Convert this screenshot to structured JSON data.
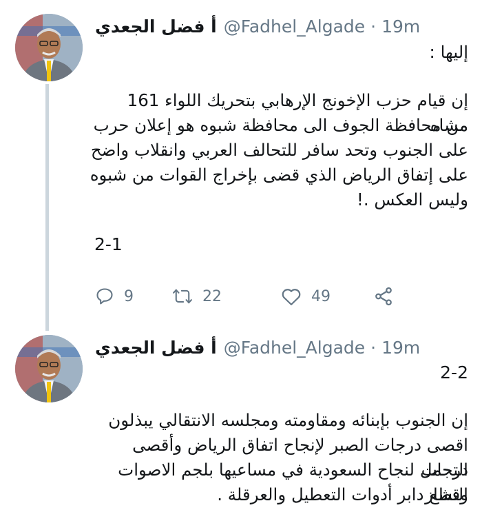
{
  "tweets": [
    {
      "author_name": "أ فضل الجعدي",
      "handle": "@Fadhel_Algade",
      "separator": "·",
      "time": "19m",
      "lines": [
        "إليها :",
        "إن قيام حزب الإخونج الإرهابي بتحريك اللواء 161 مشاه",
        "من محافظة الجوف الى محافظة شبوه هو إعلان حرب",
        "على الجنوب وتحد سافر للتحالف العربي وانقلاب واضح",
        "على إتفاق الرياض الذي قضى بإخراج القوات من شبوه",
        "وليس العكس .!"
      ],
      "thread_label": "2-1",
      "actions": {
        "reply_count": "9",
        "retweet_count": "22",
        "like_count": "49"
      }
    },
    {
      "author_name": "أ فضل الجعدي",
      "handle": "@Fadhel_Algade",
      "separator": "·",
      "time": "19m",
      "thread_label": "2-2",
      "lines": [
        "إن الجنوب بإبنائه ومقاومته ومجلسه الانتقالي يبذلون",
        "اقصى درجات الصبر لإنجاح اتفاق الرياض وأقصى درجات",
        "التحمل لنجاح السعودية في مساعيها بلجم الاصوات النشاز",
        "وقطع دابر أدوات التعطيل والعرقلة ."
      ]
    }
  ],
  "icons": {
    "reply": "reply-icon",
    "retweet": "retweet-icon",
    "like": "heart-icon",
    "share": "share-icon"
  },
  "colors": {
    "text": "#14171a",
    "muted": "#657786",
    "thread_line": "#ccd6dd"
  }
}
